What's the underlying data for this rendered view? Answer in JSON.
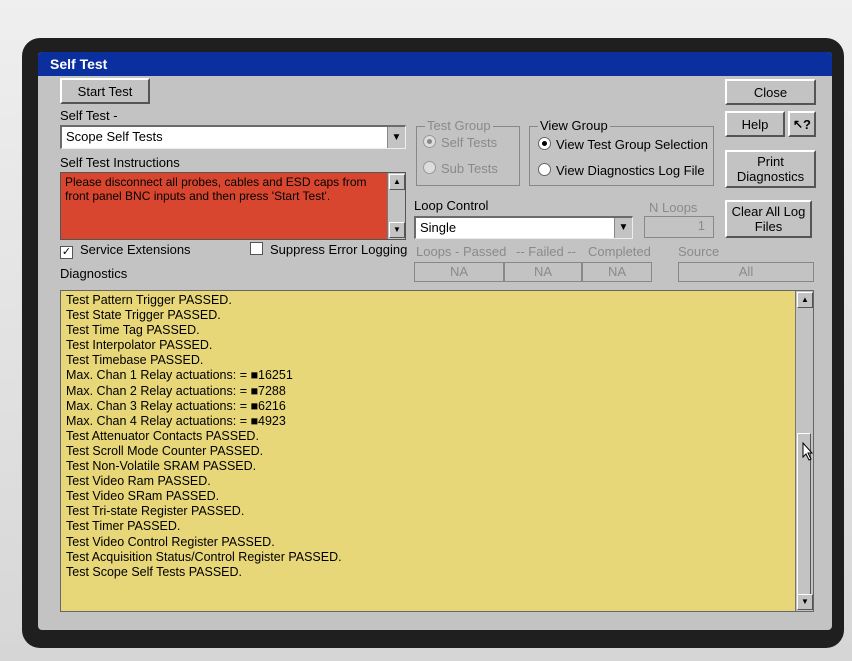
{
  "window": {
    "title": "Self Test"
  },
  "buttons": {
    "start_test": "Start Test",
    "close": "Close",
    "help": "Help",
    "help_pointer": "?",
    "print_diagnostics": "Print Diagnostics",
    "clear_all_log_files": "Clear All Log Files"
  },
  "self_test": {
    "label": "Self Test -",
    "selected": "Scope Self Tests"
  },
  "instructions": {
    "label": "Self Test Instructions",
    "text": "Please disconnect all probes, cables and ESD caps from front panel BNC inputs and then press 'Start Test'."
  },
  "test_group": {
    "title": "Test Group",
    "options": [
      "Self Tests",
      "Sub Tests"
    ],
    "selected": "Self Tests"
  },
  "view_group": {
    "title": "View Group",
    "options": [
      "View Test Group Selection",
      "View Diagnostics Log File"
    ],
    "selected": "View Test Group Selection"
  },
  "loop_control": {
    "label": "Loop Control",
    "selected": "Single",
    "n_loops_label": "N  Loops",
    "n_loops_value": "1"
  },
  "options": {
    "service_extensions": "Service Extensions",
    "service_extensions_checked": true,
    "suppress_error_logging": "Suppress Error Logging",
    "suppress_error_logging_checked": false
  },
  "stats": {
    "loops_passed_label": "Loops - Passed",
    "failed_label": "-- Failed --",
    "completed_label": "Completed",
    "source_label": "Source",
    "passed_value": "NA",
    "failed_value": "NA",
    "completed_value": "NA",
    "source_value": "All"
  },
  "diagnostics": {
    "label": "Diagnostics",
    "lines": [
      "Test Pattern Trigger PASSED.",
      "Test State Trigger PASSED.",
      "Test Time Tag PASSED.",
      "Test Interpolator PASSED.",
      "Test Timebase PASSED.",
      "Max. Chan 1 Relay actuations: = ■16251",
      "Max. Chan 2 Relay actuations: = ■7288",
      "Max. Chan 3 Relay actuations: = ■6216",
      "Max. Chan 4 Relay actuations: = ■4923",
      "Test Attenuator Contacts PASSED.",
      "Test Scroll Mode Counter PASSED.",
      "Test Non-Volatile SRAM PASSED.",
      "Test Video Ram PASSED.",
      "Test Video SRam PASSED.",
      "Test Tri-state Register PASSED.",
      "Test Timer PASSED.",
      "Test Video Control Register PASSED.",
      "Test Acquisition Status/Control Register PASSED.",
      "Test Scope Self Tests PASSED."
    ]
  },
  "icons": {
    "dropdown": "dropdown-arrow-icon",
    "scroll_up": "scroll-up-arrow-icon",
    "scroll_down": "scroll-down-arrow-icon",
    "pointer": "mouse-pointer-icon"
  },
  "colors": {
    "titlebar": "#0b2f9e",
    "instructions_bg": "#d9462f",
    "log_bg": "#e7d778",
    "dialog_bg": "#c3c3c3"
  }
}
